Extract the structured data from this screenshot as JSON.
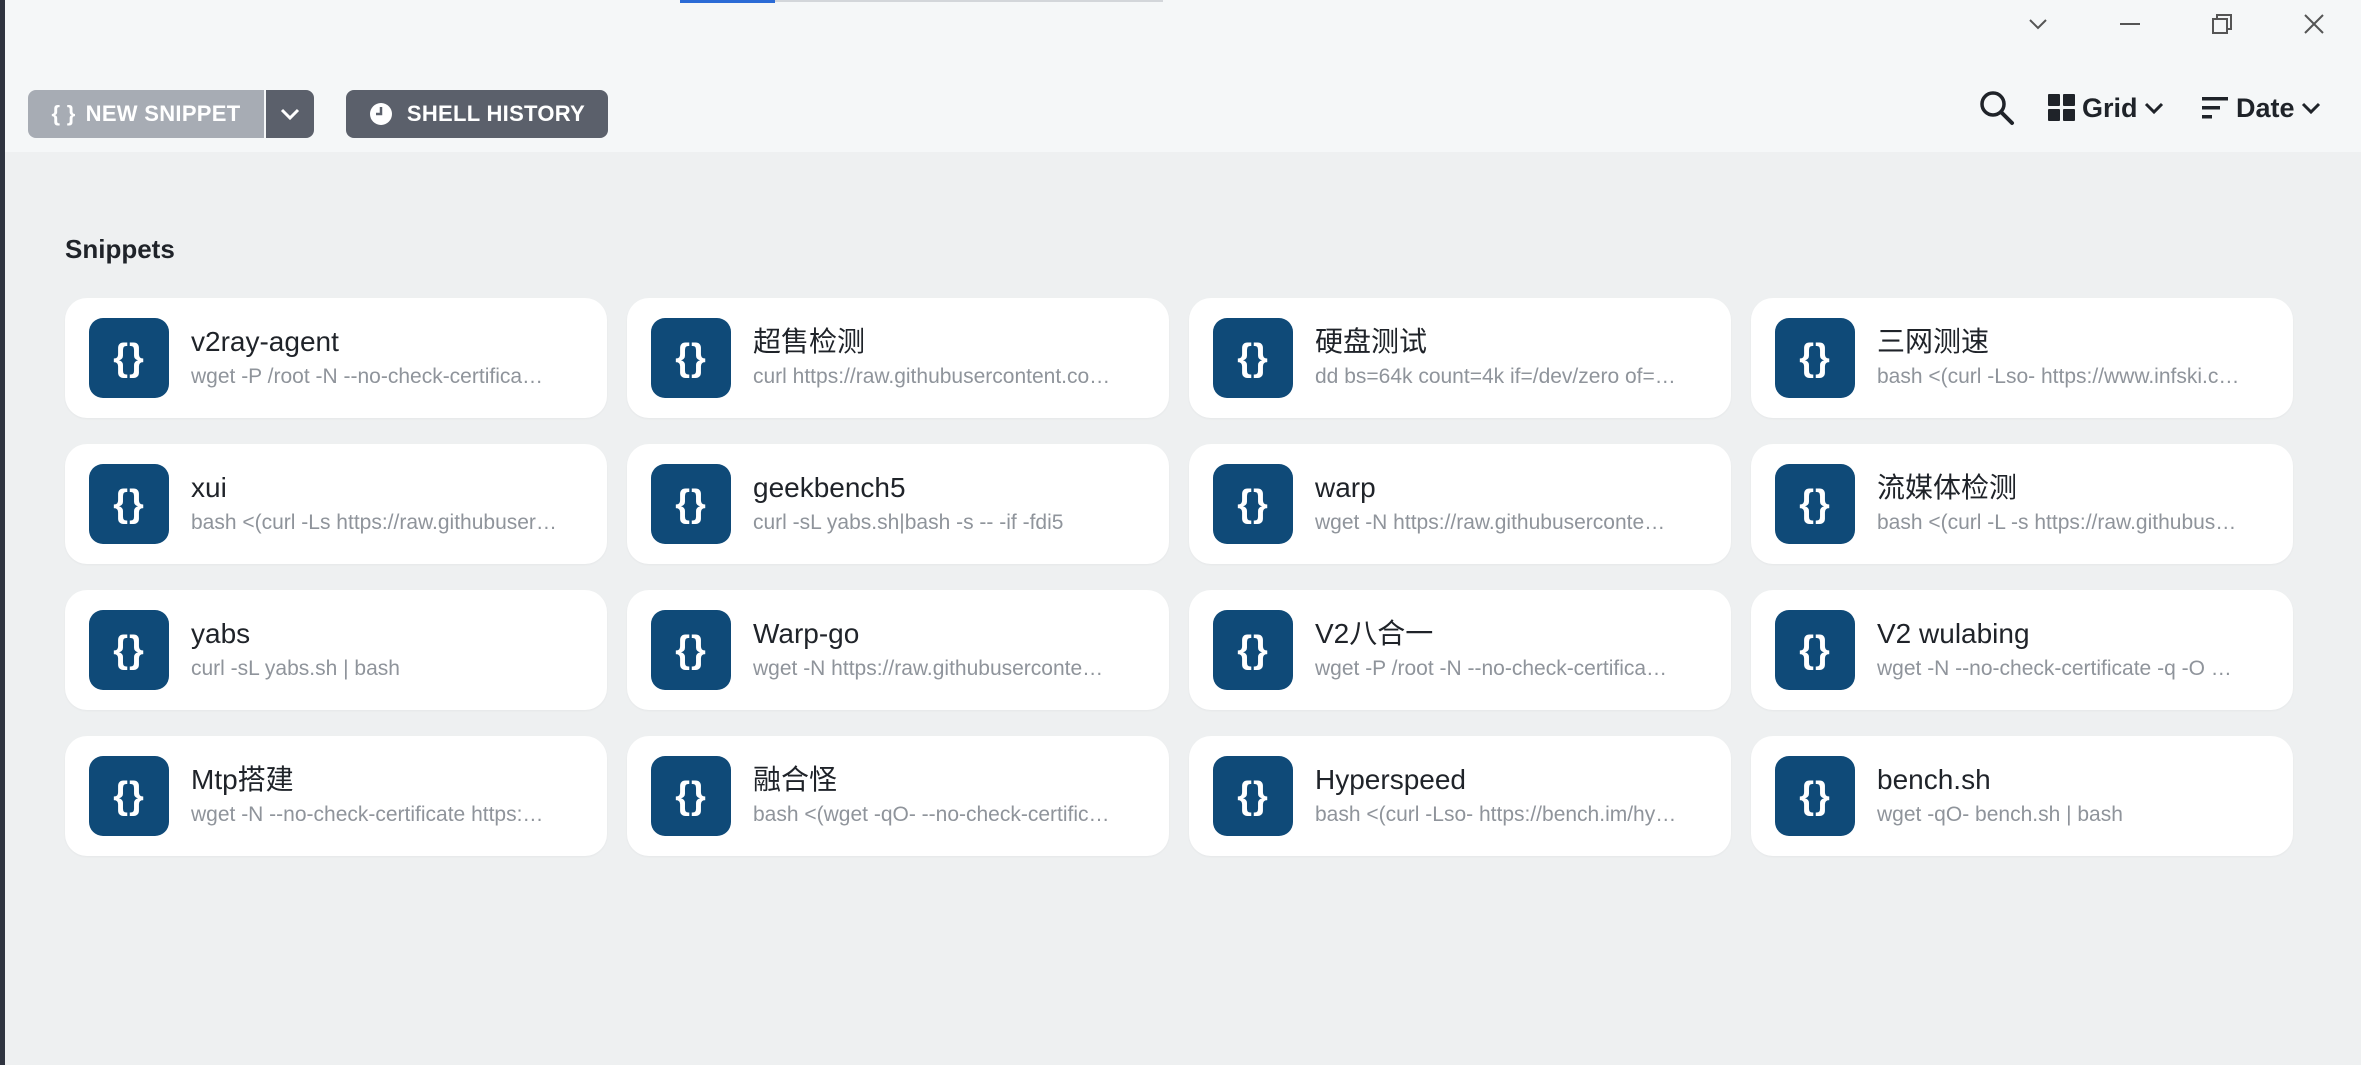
{
  "toolbar": {
    "new_snippet_label": "NEW SNIPPET",
    "new_snippet_icon": "braces-icon",
    "shell_history_label": "SHELL HISTORY",
    "view_label": "Grid",
    "sort_label": "Date"
  },
  "section": {
    "title": "Snippets"
  },
  "colors": {
    "card_icon_bg": "#0f4a78",
    "new_snippet_bg": "#a7acb4",
    "history_bg": "#5b606b",
    "page_bg": "#eef0f1"
  },
  "snippets": [
    {
      "title": "v2ray-agent",
      "command": "wget -P /root -N --no-check-certifica…"
    },
    {
      "title": "超售检测",
      "command": "curl https://raw.githubusercontent.co…"
    },
    {
      "title": "硬盘测试",
      "command": "dd bs=64k count=4k if=/dev/zero of=…"
    },
    {
      "title": "三网测速",
      "command": "bash <(curl -Lso- https://www.infski.c…"
    },
    {
      "title": "xui",
      "command": "bash <(curl -Ls https://raw.githubuser…"
    },
    {
      "title": "geekbench5",
      "command": "curl -sL yabs.sh|bash -s -- -if -fdi5"
    },
    {
      "title": "warp",
      "command": "wget -N https://raw.githubuserconte…"
    },
    {
      "title": "流媒体检测",
      "command": "bash <(curl -L -s https://raw.githubus…"
    },
    {
      "title": "yabs",
      "command": "curl -sL yabs.sh | bash"
    },
    {
      "title": "Warp-go",
      "command": "wget -N https://raw.githubuserconte…"
    },
    {
      "title": "V2八合一",
      "command": "wget -P /root -N --no-check-certifica…"
    },
    {
      "title": "V2 wulabing",
      "command": "wget -N --no-check-certificate -q -O …"
    },
    {
      "title": "Mtp搭建",
      "command": "wget -N --no-check-certificate https:…"
    },
    {
      "title": "融合怪",
      "command": "bash <(wget -qO- --no-check-certific…"
    },
    {
      "title": "Hyperspeed",
      "command": "bash <(curl -Lso- https://bench.im/hy…"
    },
    {
      "title": "bench.sh",
      "command": "wget -qO- bench.sh | bash"
    }
  ]
}
